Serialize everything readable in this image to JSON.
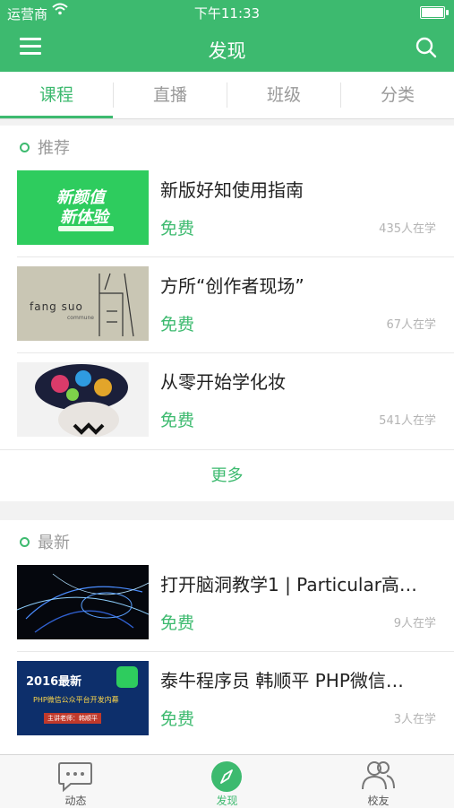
{
  "status_bar": {
    "carrier": "运营商",
    "time": "下午11:33"
  },
  "nav": {
    "title": "发现"
  },
  "tabs": [
    {
      "label": "课程"
    },
    {
      "label": "直播"
    },
    {
      "label": "班级"
    },
    {
      "label": "分类"
    }
  ],
  "recommended": {
    "header": "推荐",
    "items": [
      {
        "title": "新版好知使用指南",
        "price": "免费",
        "learners": "435人在学",
        "thumb_text": [
          "新颜值",
          "新体验"
        ]
      },
      {
        "title": "方所“创作者现场”",
        "price": "免费",
        "learners": "67人在学",
        "thumb_text": [
          "fang suo",
          "commune"
        ]
      },
      {
        "title": "从零开始学化妆",
        "price": "免费",
        "learners": "541人在学"
      }
    ],
    "more_label": "更多"
  },
  "latest": {
    "header": "最新",
    "items": [
      {
        "title": "打开脑洞教学1 | Particular高…",
        "price": "免费",
        "learners": "9人在学"
      },
      {
        "title": "泰牛程序员 韩顺平 PHP微信…",
        "price": "免费",
        "learners": "3人在学",
        "thumb_text": [
          "2016最新",
          "PHP微信公众平台开发内幕",
          "主讲老师：韩顺平"
        ]
      }
    ]
  },
  "bottom_tabs": [
    {
      "label": "动态",
      "icon": "chat-bubble-icon"
    },
    {
      "label": "发现",
      "icon": "compass-icon"
    },
    {
      "label": "校友",
      "icon": "people-icon"
    }
  ],
  "colors": {
    "accent": "#3dba6f",
    "muted_text": "#9a9a9a",
    "background": "#f2f2f2"
  }
}
